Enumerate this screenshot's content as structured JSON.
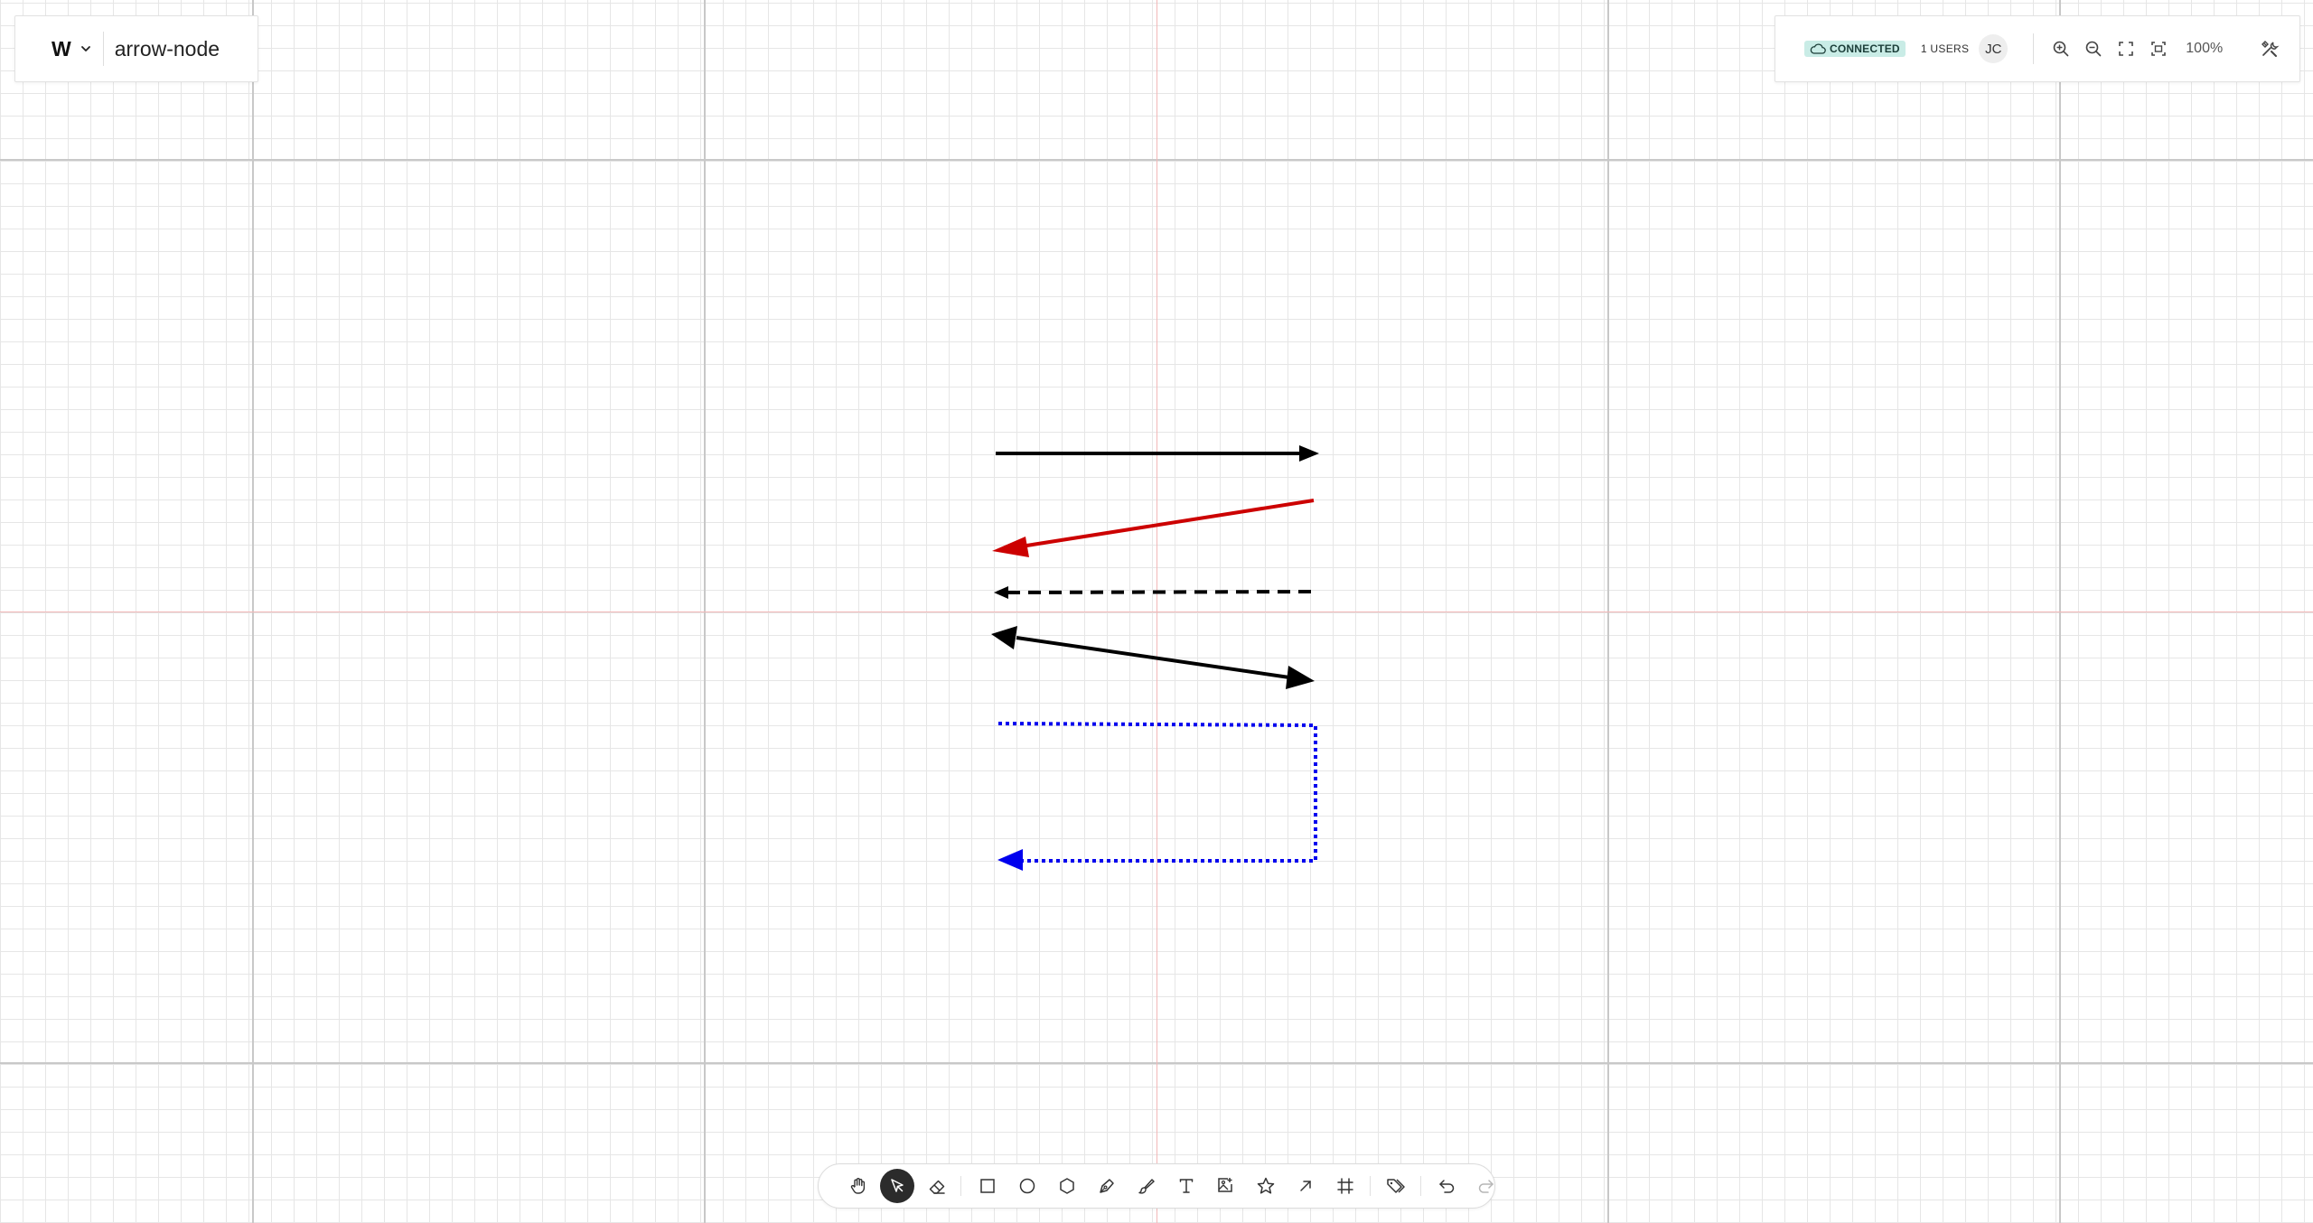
{
  "document": {
    "logo_letter": "W",
    "title": "arrow-node"
  },
  "status": {
    "connection": "CONNECTED",
    "users": "1 USERS",
    "avatar_initials": "JC",
    "zoom": "100%"
  },
  "toolbar": {
    "tools": [
      "hand",
      "select",
      "eraser",
      "rectangle",
      "ellipse",
      "polygon",
      "pen",
      "brush",
      "text",
      "image",
      "star",
      "arrow",
      "frame",
      "tag",
      "undo",
      "redo"
    ],
    "active_tool": "select"
  },
  "canvas": {
    "shapes": [
      {
        "type": "arrow",
        "stroke": "#000000",
        "style": "solid",
        "heads": "end"
      },
      {
        "type": "arrow",
        "stroke": "#cc0000",
        "style": "solid",
        "heads": "end"
      },
      {
        "type": "arrow",
        "stroke": "#000000",
        "style": "dashed",
        "heads": "end"
      },
      {
        "type": "arrow",
        "stroke": "#000000",
        "style": "solid",
        "heads": "both"
      },
      {
        "type": "elbow-arrow",
        "stroke": "#0000ee",
        "style": "dotted",
        "heads": "end"
      }
    ],
    "colors": {
      "grid": "#e6e6e6",
      "major_grid": "#c8c8c8",
      "origin_axis": "#f2b8b8",
      "accent": "#c9ece6"
    }
  }
}
